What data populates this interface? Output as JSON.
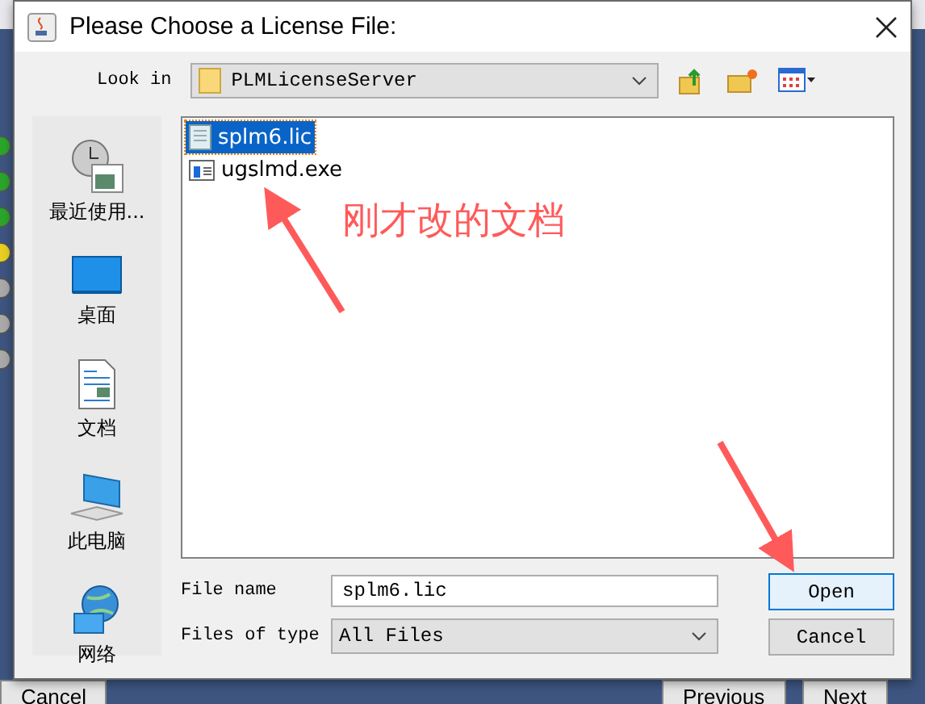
{
  "background_window": {
    "status_icons": [
      {
        "kind": "done"
      },
      {
        "kind": "done"
      },
      {
        "kind": "done"
      },
      {
        "kind": "warning"
      },
      {
        "kind": "pending"
      },
      {
        "kind": "pending"
      },
      {
        "kind": "pending"
      }
    ],
    "buttons": [
      {
        "label": "Cancel"
      },
      {
        "label": "Previous"
      },
      {
        "label": "Next"
      }
    ]
  },
  "dialog": {
    "title": "Please Choose a License File:",
    "look_in": {
      "label": "Look in",
      "value": "PLMLicenseServer"
    },
    "places": [
      {
        "kind": "recent",
        "label": "最近使用..."
      },
      {
        "kind": "desktop",
        "label": "桌面"
      },
      {
        "kind": "documents",
        "label": "文档"
      },
      {
        "kind": "computer",
        "label": "此电脑"
      },
      {
        "kind": "network",
        "label": "网络"
      }
    ],
    "files": [
      {
        "kind": "text",
        "name": "splm6.lic",
        "selected": true
      },
      {
        "kind": "program",
        "name": "ugslmd.exe",
        "selected": false
      }
    ],
    "file_name": {
      "label": "File name",
      "value": "splm6.lic"
    },
    "file_type": {
      "label": "Files of type",
      "value": "All Files"
    },
    "buttons": [
      {
        "label": "Open",
        "default": true
      },
      {
        "label": "Cancel",
        "default": false
      }
    ]
  },
  "annotation": {
    "text": "刚才改的文档"
  }
}
